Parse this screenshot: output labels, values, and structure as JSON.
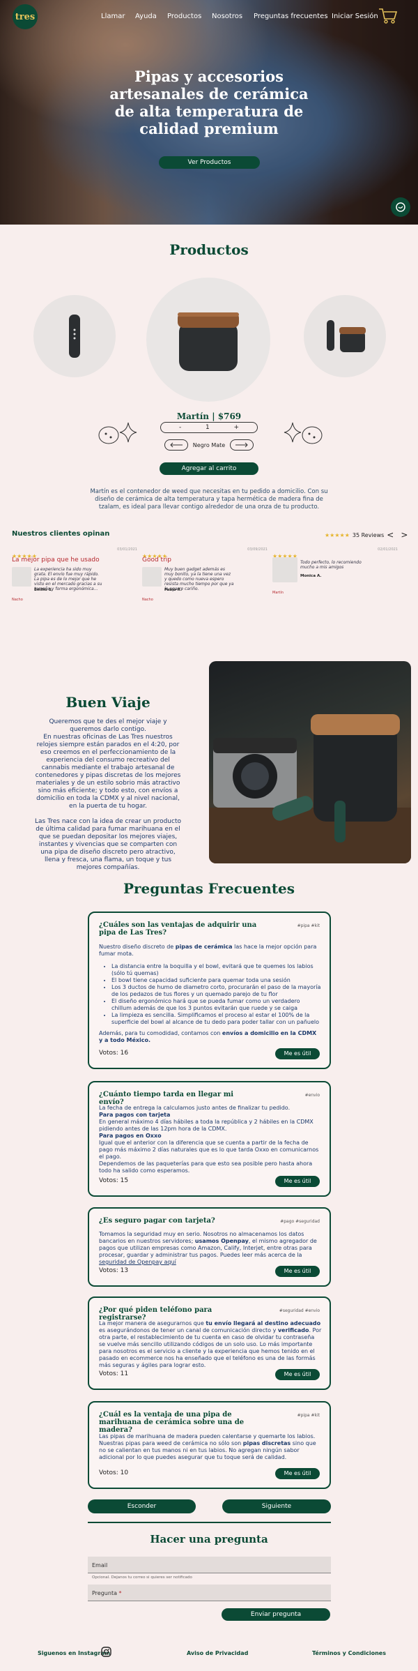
{
  "nav": {
    "logo_text": "tres",
    "items": [
      "Llamar",
      "Ayuda",
      "Productos",
      "Nosotros",
      "Preguntas frecuentes",
      "Iniciar Sesión"
    ]
  },
  "hero": {
    "title": "Pipas y accesorios artesanales de cerámica de alta temperatura de calidad premium",
    "button": "Ver Productos"
  },
  "products": {
    "title": "Productos",
    "price": "Martín | $769",
    "qty_minus": "-",
    "qty": "1",
    "qty_plus": "+",
    "color": "Negro Mate",
    "add_to_cart": "Agregar al carrito",
    "description": "Martín es el contenedor de weed que necesitas en tu pedido a domicilio. Con su diseño de cerámica de alta temperatura y tapa hermética de madera fina de tzalam, es ideal para llevar contigo alrededor de una onza de tu producto."
  },
  "reviews": {
    "title": "Nuestros clientes opinan",
    "stars": "★★★★★",
    "count": "35 Reviews",
    "items": [
      {
        "date": "03/01/2021",
        "headline": "La mejor pipa que he usado",
        "text": "La experiencia ha sido muy grata. El envío fue muy rápido. La pipa es de lo mejor que he visto en el mercado gracias a su tamaño y forma ergonómica...",
        "name": "Emilio S.",
        "product": "Nacho"
      },
      {
        "date": "03/09/2021",
        "headline": "Good trip",
        "text": "Muy buen gadget además es muy bonito, ya la tiene una vez y quedo como nueva espero resista mucho tiempo por que ya le agarre cariño.",
        "name": "Fabio R.",
        "product": "Nacho"
      },
      {
        "date": "02/01/2021",
        "headline": "",
        "text": "Todo perfecto, lo recomiendo mucho a mis amigos",
        "name": "Monica A.",
        "product": "Martín"
      }
    ]
  },
  "about": {
    "title": "Buen Viaje",
    "p1": "Queremos que te des el mejor viaje y queremos darlo contigo.",
    "p2": "En nuestras oficinas de Las Tres nuestros relojes siempre están parados en el 4:20, por eso creemos en el perfeccionamiento de la experiencia del consumo recreativo del cannabis mediante el trabajo artesanal de contenedores y pipas discretas de los mejores materiales y de un estilo sobrio más atractivo sino más eficiente; y todo esto, con envíos a domicilio en toda la CDMX y al nivel nacional, en la puerta de tu hogar.",
    "p3": "Las Tres nace con la idea de crear un producto de última calidad para fumar marihuana en el que se puedan depositar los mejores viajes, instantes y vivencias que se comparten con una pipa de diseño discreto pero atractivo, llena y fresca, una flama, un toque y tus mejores compañías."
  },
  "faq": {
    "title": "Preguntas Frecuentes",
    "votes_label": "Votos:",
    "useful": "Me es útil",
    "items": [
      {
        "q": "¿Cuáles son las ventajas de adquirir una pipa de Las Tres?",
        "tag": "#pipa #kit",
        "intro_a": "Nuestro diseño discreto de ",
        "intro_b": "pipas de cerámica",
        "intro_c": " las hace la mejor opción para fumar mota.",
        "bullets": [
          "La distancia entre la boquilla y el bowl, evitará que te quemes los labios (sólo tú quemas)",
          "El bowl tiene capacidad suficiente para quemar toda una sesión",
          "Los 3 ductos de humo de diametro corto, procurarán el paso de la mayoría de los pedazos de tus flores y un quemado parejo de tu flor",
          "El diseño ergonómico hará que se pueda fumar como un verdadero chillum además de que los 3 puntos evitarán que ruede y se caiga",
          "La limpieza es sencilla. Simplificamos el proceso al estar el 100% de la superficie del bowl al alcance de tu dedo para poder tallar con un pañuelo"
        ],
        "outro_a": "Además, para tu comodidad, contamos con ",
        "outro_b": "envíos a domicilio en la CDMX y a todo México.",
        "votes": "16"
      },
      {
        "q": "¿Cuánto tiempo tarda en llegar mi envío?",
        "tag": "#envio",
        "a1": "La fecha de entrega la calculamos justo antes de finalizar tu pedido.",
        "h1": "Para pagos con tarjeta",
        "a2": "En general máximo 4 días hábiles a toda la república y 2 hábiles en la CDMX pidiendo antes de las 12pm hora de la CDMX.",
        "h2": "Para pagos en Oxxo",
        "a3": "Igual que el anterior con la diferencia que se cuenta a partir de la fecha de pago más máximo 2 días naturales que es lo que tarda Oxxo en comunicarnos el pago.",
        "a4": "Dependemos de las paqueterías para que esto sea posible pero hasta ahora todo ha salido como esperamos.",
        "votes": "15"
      },
      {
        "q": "¿Es seguro pagar con tarjeta?",
        "tag": "#pago #seguridad",
        "a1": "Tomamos la seguridad muy en serio. Nosotros no almacenamos los datos bancarios en nuestros servidores; ",
        "a2": "usamos Openpay",
        "a3": ", el mismo agregador de pagos que utilizan empresas como Amazon, Calify, Interjet, entre otras para procesar, guardar y administrar tus pagos. Puedes leer más acerca de la ",
        "link": "seguridad de Openpay aquí",
        "votes": "13"
      },
      {
        "q": "¿Por qué piden teléfono para registrarse?",
        "tag": "#seguridad #envio",
        "a1": "La mejor manera de asegurarnos que ",
        "a2": "tu envío llegará al destino adecuado",
        "a3": " es asegurándonos de tener un canal de comunicación directo y ",
        "a4": "verificado",
        "a5": ". Por otra parte, el restablecimiento de tu cuenta en caso de olvidar tu contraseña se vuelve más sencillo utilizando códigos de un solo uso. Lo más importante para nosotros es el servicio a cliente y la experiencia que hemos tenido en el pasado en ecommerce nos ha enseñado que el teléfono es una de las formás más seguras y ágiles para lograr esto.",
        "votes": "11"
      },
      {
        "q": "¿Cuál es la ventaja de una pipa de marihuana de cerámica sobre una de madera?",
        "tag": "#pipa #kit",
        "a1": "Las pipas de marihuana de madera pueden calentarse y quemarte los labios. Nuestras pipas para weed de cerámica no sólo son ",
        "a2": "pipas discretas",
        "a3": " sino que no se calientan en tus manos ni en tus labios. No agregan ningún sabor adicional por lo que puedes asegurar que tu toque será de calidad.",
        "votes": "10"
      }
    ],
    "hide": "Esconder",
    "next": "Siguiente"
  },
  "ask": {
    "title": "Hacer una pregunta",
    "email": "Email",
    "hint": "Opcional. Dejanos tu correo si quieres ser notificado",
    "question": "Pregunta",
    "required": "*",
    "submit": "Enviar pregunta"
  },
  "footer": {
    "instagram": "Siguenos en Instagram",
    "privacy": "Aviso de Privacidad",
    "terms": "Términos y Condiciones"
  },
  "colors": {
    "accent": "#0b4a35",
    "background": "#f8eeed",
    "stars": "#e6b52e",
    "review_headline": "#b5282e"
  }
}
